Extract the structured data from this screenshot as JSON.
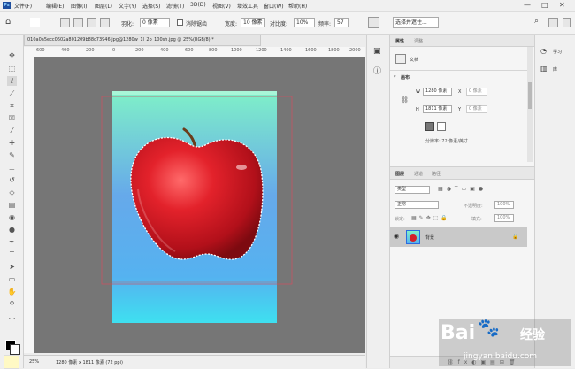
{
  "app": {
    "logo": "Ps"
  },
  "menu": [
    "文件(F)",
    "编辑(E)",
    "图像(I)",
    "图层(L)",
    "文字(Y)",
    "选择(S)",
    "滤镜(T)",
    "3D(D)",
    "视图(V)",
    "增效工具",
    "窗口(W)",
    "帮助(H)"
  ],
  "window_controls": {
    "minimize": "—",
    "maximize": "□",
    "close": "✕"
  },
  "options": {
    "feather_label": "羽化:",
    "feather_value": "0 像素",
    "antialias_label": "消除锯齿",
    "width_label": "宽度:",
    "width_value": "10 像素",
    "contrast_label": "对比度:",
    "contrast_value": "10%",
    "frequency_label": "频率:",
    "frequency_value": "57",
    "select_subject_label": "选择并遮住..."
  },
  "document_tab": "010a0a5ecc0602a801209b88c73946.jpg@1280w_1l_2o_100sh.jpg @ 25%(RGB/8) *",
  "ruler_h": [
    "600",
    "400",
    "200",
    "0",
    "200",
    "400",
    "600",
    "800",
    "1000",
    "1200",
    "1400",
    "1600",
    "1800",
    "2000"
  ],
  "status": {
    "zoom": "25%",
    "info": "1280 像素 x 1811 像素 (72 ppi)"
  },
  "properties_panel": {
    "tabs": [
      "属性",
      "调整"
    ],
    "doc_label": "文档",
    "canvas_heading": "画布",
    "w_label": "W",
    "w_value": "1280 像素",
    "x_label": "X",
    "x_value": "0 像素",
    "h_label": "H",
    "h_value": "1811 像素",
    "y_label": "Y",
    "y_value": "0 像素",
    "resolution": "分辨率: 72 像素/英寸"
  },
  "layers_panel": {
    "tabs": [
      "图层",
      "通道",
      "路径"
    ],
    "kind_label": "类型",
    "blend_mode": "正常",
    "opacity_label": "不透明度:",
    "opacity_value": "100%",
    "lock_label": "锁定:",
    "fill_label": "填充:",
    "fill_value": "100%",
    "layer_name": "背景"
  },
  "right_panel": {
    "learn_label": "学习",
    "libraries_label": "库"
  },
  "watermark": {
    "brand": "Bai",
    "jingyan": "经验",
    "url": "jingyan.baidu.com"
  }
}
